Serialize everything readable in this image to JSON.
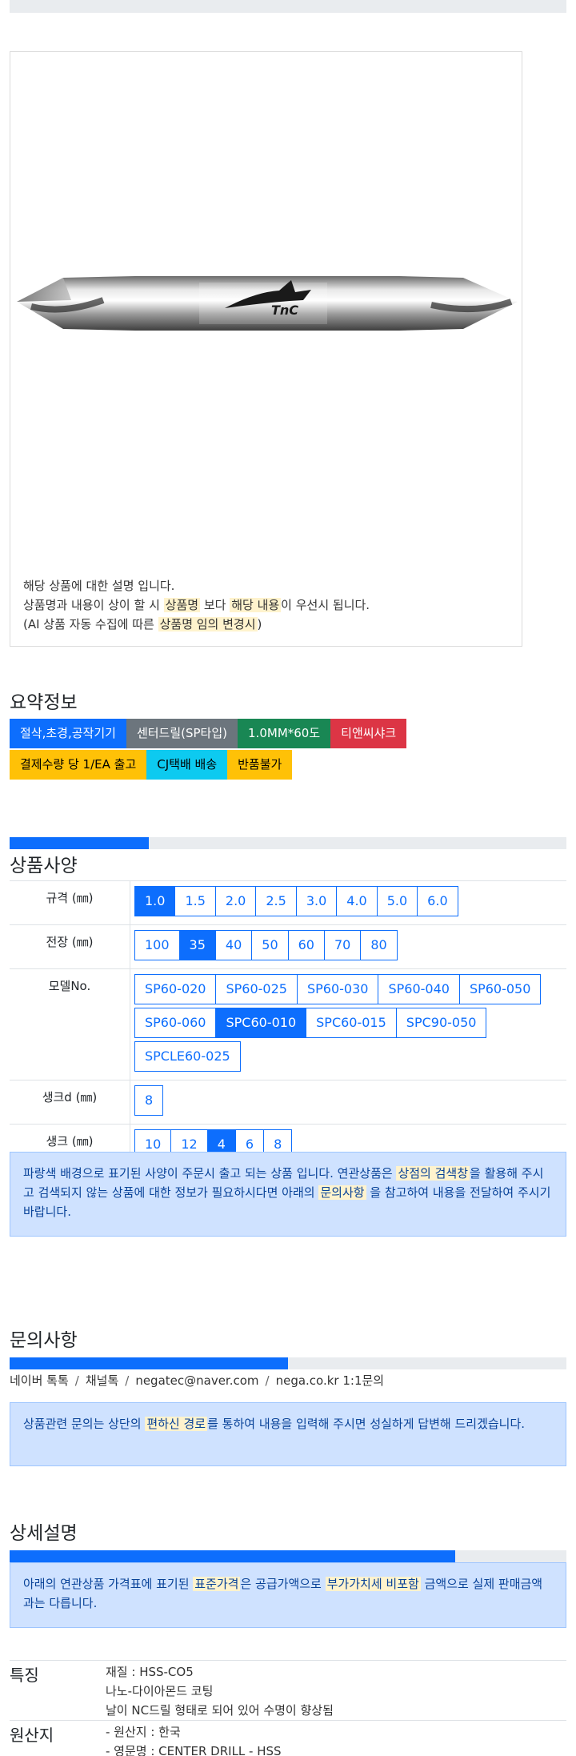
{
  "product": {
    "desc_line1": "해당 상품에 대한 설명 입니다.",
    "desc_line2_a": "상품명과 내용이 상이 할 시 ",
    "desc_line2_hl1": "상품명",
    "desc_line2_b": " 보다 ",
    "desc_line2_hl2": "해당 내용",
    "desc_line2_c": "이 우선시 됩니다.",
    "desc_line3_a": "(AI 상품 자동 수집에 따른 ",
    "desc_line3_hl": "상품명 임의 변경시",
    "desc_line3_b": ")",
    "image_logo_text": "TnC"
  },
  "summary": {
    "title": "요약정보",
    "badges_row1": [
      {
        "label": "절삭,초경,공작기기",
        "color": "#0d6efd"
      },
      {
        "label": "센터드릴(SP타입)",
        "color": "#6c757d"
      },
      {
        "label": "1.0MM*60도",
        "color": "#198754"
      },
      {
        "label": "티앤씨샤크",
        "color": "#dc3545"
      }
    ],
    "badges_row2": [
      {
        "label": "결제수량 당 1/EA 출고",
        "color": "#ffc107"
      },
      {
        "label": "CJ택배 배송",
        "color": "#0dcaf0"
      },
      {
        "label": "반품불가",
        "color": "#ffc107"
      }
    ]
  },
  "specs": {
    "progress": 0.25,
    "title": "상품사양",
    "rows": [
      {
        "label": "규격 (㎜)",
        "options": [
          "1.0",
          "1.5",
          "2.0",
          "2.5",
          "3.0",
          "4.0",
          "5.0",
          "6.0"
        ],
        "selected": "1.0"
      },
      {
        "label": "전장 (㎜)",
        "options": [
          "100",
          "35",
          "40",
          "50",
          "60",
          "70",
          "80"
        ],
        "selected": "35"
      },
      {
        "label": "모델No.",
        "options": [
          "SP60-020",
          "SP60-025",
          "SP60-030",
          "SP60-040",
          "SP60-050",
          "SP60-060",
          "SPC60-010",
          "SPC60-015",
          "SPC90-050",
          "SPCLE60-025"
        ],
        "selected": "SPC60-010"
      },
      {
        "label": "생크d (㎜)",
        "options": [
          "8"
        ],
        "selected": ""
      },
      {
        "label": "생크 (㎜)",
        "options": [
          "10",
          "12",
          "4",
          "6",
          "8"
        ],
        "selected": "4"
      }
    ],
    "notice_a": "파랑색 배경으로 표기된 사양이 주문시 출고 되는 상품 입니다. 연관상품은 ",
    "notice_hl1": "상점의 검색창",
    "notice_b": "을 활용해 주시고 검색되지 않는 상품에 대한 정보가 필요하시다면 아래의 ",
    "notice_hl2": "문의사항",
    "notice_c": " 을 참고하여 내용을 전달하여 주시기 바랍니다."
  },
  "inquiry": {
    "title": "문의사항",
    "progress": 0.5,
    "channels": [
      "네이버 톡톡",
      "채널톡",
      "negatec@naver.com",
      "nega.co.kr 1:1문의"
    ],
    "notice_a": "상품관련 문의는 상단의 ",
    "notice_hl": "편하신 경로",
    "notice_b": "를 통하여 내용을 입력해 주시면 성실하게 답변해 드리겠습니다."
  },
  "detail": {
    "title": "상세설명",
    "progress": 0.8,
    "notice_a": "아래의 연관상품 가격표에 표기된 ",
    "notice_hl1": "표준가격",
    "notice_b": "은 공급가액으로 ",
    "notice_hl2": "부가가치세 비포함",
    "notice_c": " 금액으로 실제 판매금액과는 다릅니다."
  },
  "features": [
    {
      "label": "특징",
      "lines": [
        "재질 : HSS-CO5",
        "나노-다이아몬드 코팅",
        "날이 NC드릴 형태로 되어 있어 수명이 향상됨"
      ]
    },
    {
      "label": "원산지",
      "lines": [
        "- 원산지 : 한국",
        "- 영문명 : CENTER DRILL - HSS"
      ]
    }
  ],
  "colors": {
    "accent": "#0d6efd",
    "info_bg": "#cfe2ff",
    "highlight": "#fff3cd"
  }
}
